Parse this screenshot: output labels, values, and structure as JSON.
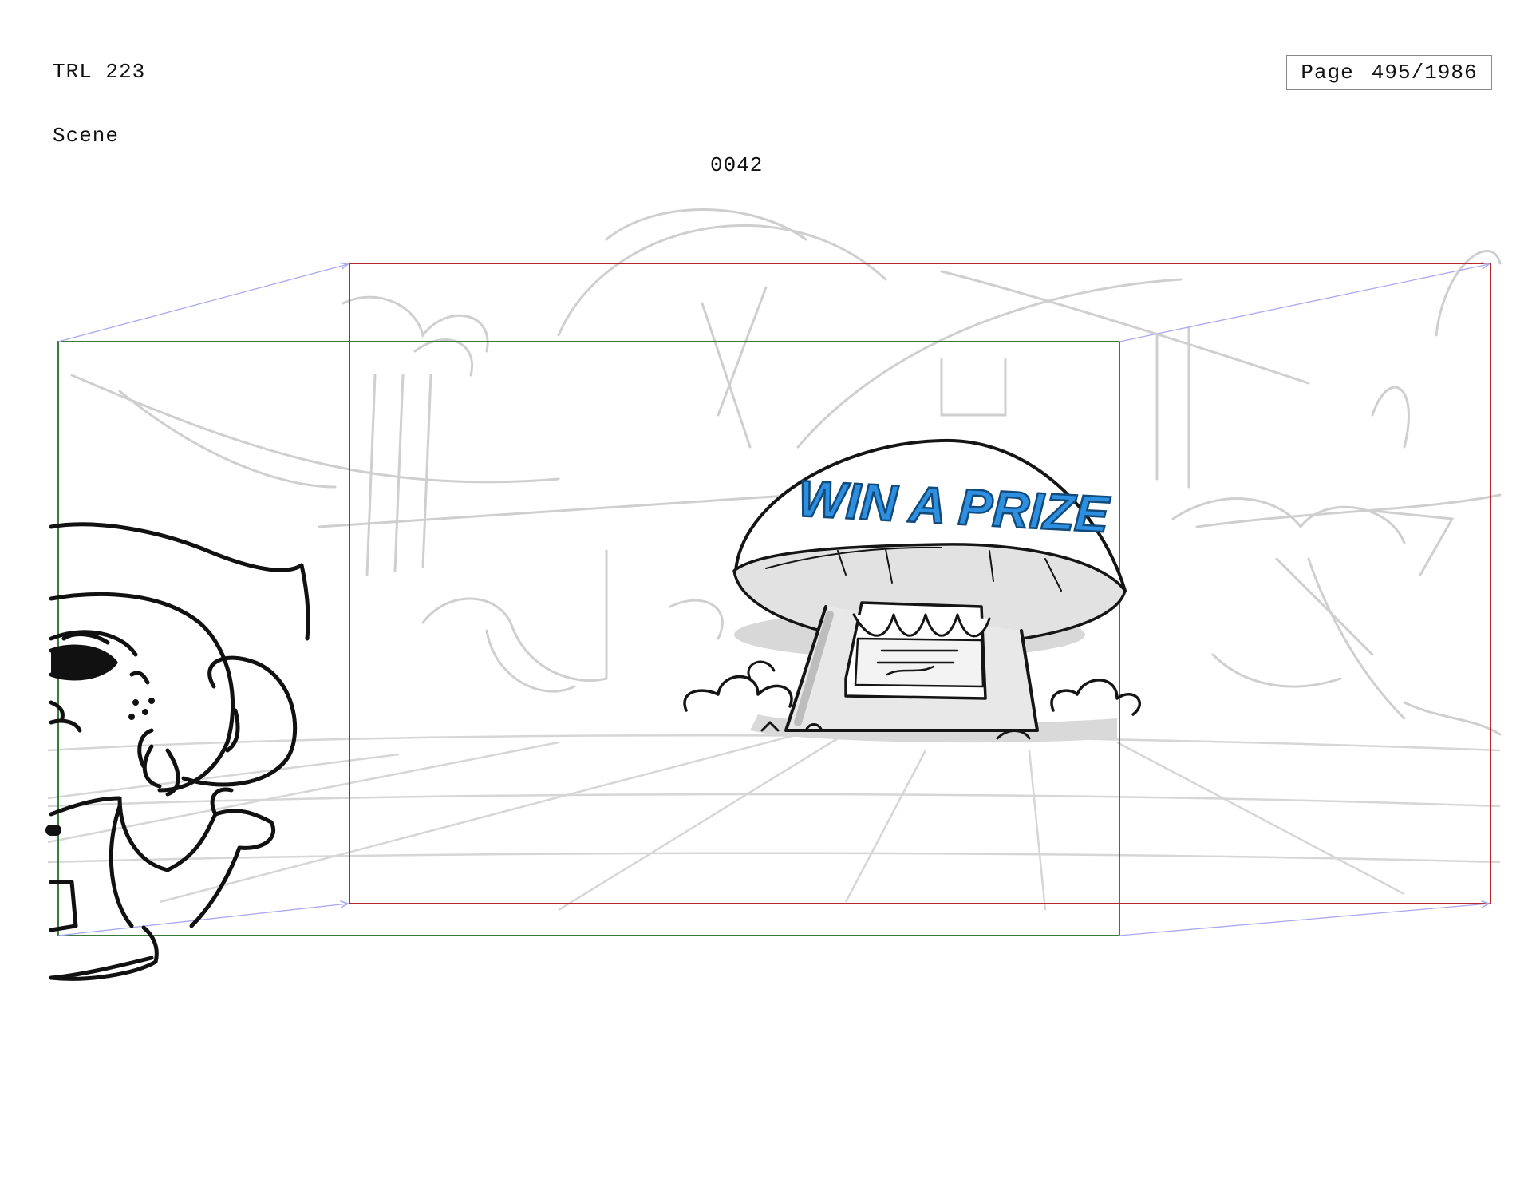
{
  "header": {
    "production_code": "TRL 223",
    "scene_label": "Scene",
    "scene_number": "0042",
    "page_label": "Page",
    "page_value": "495/1986"
  },
  "panel": {
    "sign_text": "WIN A PRIZE",
    "frame_colors": {
      "start_frame": "#3a7a3a",
      "end_frame": "#b2282e",
      "camera_move_arrows": "#a9a9f0",
      "sign_fill": "#2e8fe0"
    }
  }
}
